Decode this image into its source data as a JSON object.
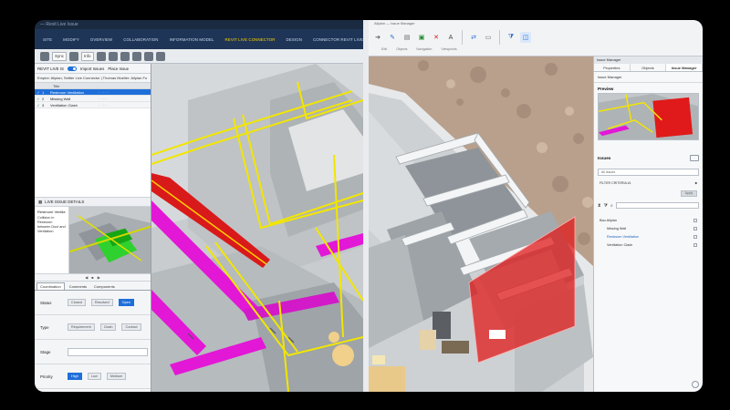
{
  "left_app": {
    "title": "— Revit Live Issue",
    "ribbon_tabs": [
      "SITE",
      "MODIFY",
      "OVERVIEW",
      "COLLABORATION",
      "INFORMATION MODEL",
      "REVIT LIVE CONNECTOR",
      "DESIGN",
      "CONNECTOR REVIT LIVE"
    ],
    "active_tab": "REVIT LIVE CONNECTOR",
    "toolbar": {
      "sync": "Sync",
      "info": "Info",
      "bar_a": "Import Issues",
      "bar_b": "Place Issue"
    },
    "panel": {
      "header_label": "REVIT LIVE IS",
      "path": "Empire: Allplan, Settler Live Connector | Thomas Mueller: Allplan Fo",
      "col_header": "Title",
      "issues": [
        {
          "num": "1",
          "name": "Restroom Ventilation",
          "selected": true,
          "status": "✓"
        },
        {
          "num": "2",
          "name": "Missing Wall",
          "selected": false,
          "status": "✓"
        },
        {
          "num": "3",
          "name": "Ventilation Clash",
          "selected": false,
          "status": "✓"
        }
      ],
      "details_header": "LIVE ISSUE DETAILS",
      "detail_title": "Restroom Ventila",
      "detail_desc": "Collision in Restroom between Duct and Ventilation",
      "sub_tabs": [
        "Coordination",
        "Comments",
        "Components"
      ],
      "fields": [
        {
          "label": "Status",
          "options": [
            "Closed",
            "Resolved",
            "Open"
          ],
          "on": "Open"
        },
        {
          "label": "Type",
          "options": [
            "Requirement",
            "Clash",
            "Contact"
          ],
          "on": ""
        },
        {
          "label": "Stage",
          "options": [],
          "on": ""
        },
        {
          "label": "Priority",
          "options": [
            "High",
            "Low",
            "Medium"
          ],
          "on": "High"
        }
      ]
    }
  },
  "right_app": {
    "title": "Allplan — Issue Manager",
    "groups": [
      "Edit",
      "Objects",
      "Navigation",
      "Viewpoints"
    ],
    "panel": {
      "title": "Issue Manager",
      "tabs": [
        "Properties",
        "Objects",
        "Issue Manager"
      ],
      "active_tab": "Issue Manager",
      "subtitle": "Issue Manager",
      "preview_label": "Preview",
      "issues_label": "Issues",
      "select_value": "All issues",
      "issue_id": "FILTER CRITERIA #1",
      "apply_button": "Apply",
      "tree_root": "Bau Allplan",
      "tree_items": [
        "Missing Wall",
        "Restroom Ventilation",
        "Ventilation Clash"
      ],
      "selected_item": "Restroom Ventilation"
    }
  },
  "colors": {
    "accent_blue": "#1e6fd9",
    "clash_red": "#e01a1a",
    "duct_magenta": "#e317d6",
    "pipe_yellow": "#f2e600",
    "ribbon": "#1f3557"
  }
}
